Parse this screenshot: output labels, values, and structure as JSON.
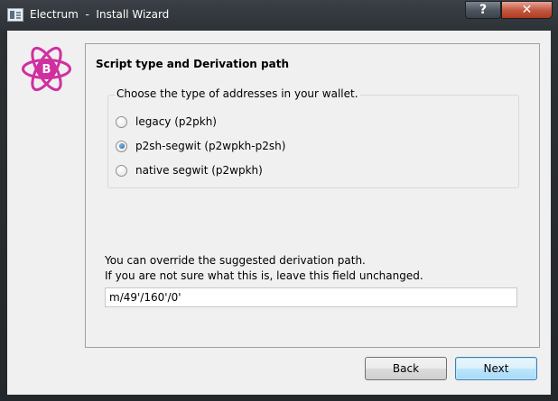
{
  "window": {
    "title": "Electrum  -  Install Wizard",
    "help_label": "?",
    "close_label": "✕"
  },
  "colors": {
    "logo_accent": "#d0309f",
    "selected_radio": "#1d5d9c",
    "default_button_border": "#3c7fb1"
  },
  "icons": [
    "electrum-logo-icon",
    "app-icon",
    "help-icon",
    "close-icon"
  ],
  "page": {
    "title": "Script type and Derivation path",
    "address_group": {
      "title": "Choose the type of addresses in your wallet.",
      "options": [
        {
          "label": "legacy (p2pkh)",
          "checked": false
        },
        {
          "label": "p2sh-segwit (p2wpkh-p2sh)",
          "checked": true
        },
        {
          "label": "native segwit (p2wpkh)",
          "checked": false
        }
      ]
    },
    "hint_line1": "You can override the suggested derivation path.",
    "hint_line2": "If you are not sure what this is, leave this field unchanged.",
    "derivation_path": "m/49'/160'/0'"
  },
  "buttons": {
    "back": "Back",
    "next": "Next"
  }
}
